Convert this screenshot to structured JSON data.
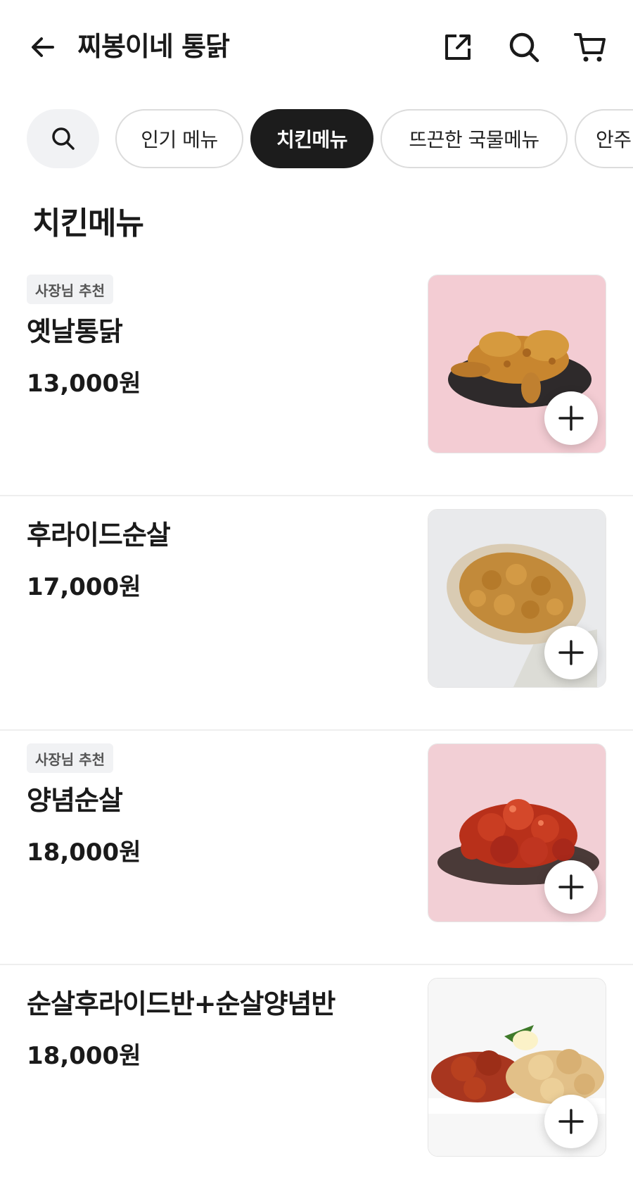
{
  "header": {
    "title": "찌봉이네 통닭",
    "icons": [
      "back-arrow-icon",
      "share-icon",
      "search-icon",
      "cart-icon"
    ]
  },
  "categories": [
    {
      "label": "인기 메뉴",
      "active": false
    },
    {
      "label": "치킨메뉴",
      "active": true
    },
    {
      "label": "뜨끈한 국물메뉴",
      "active": false
    },
    {
      "label": "안주",
      "active": false
    }
  ],
  "section": {
    "title": "치킨메뉴"
  },
  "menu": [
    {
      "badge": "사장님 추천",
      "name": "옛날통닭",
      "price": "13,000원",
      "photo_background": "#f3ccd3"
    },
    {
      "badge": "",
      "name": "후라이드순살",
      "price": "17,000원",
      "photo_background": "#e9eaec"
    },
    {
      "badge": "사장님 추천",
      "name": "양념순살",
      "price": "18,000원",
      "photo_background": "#f2cfd5"
    },
    {
      "badge": "",
      "name": "순살후라이드반+순살양념반",
      "price": "18,000원",
      "photo_background": "#f7f7f7"
    }
  ],
  "colors": {
    "active_chip": "#1c1c1c",
    "badge_bg": "#f1f2f4",
    "divider": "#eeeeee"
  }
}
